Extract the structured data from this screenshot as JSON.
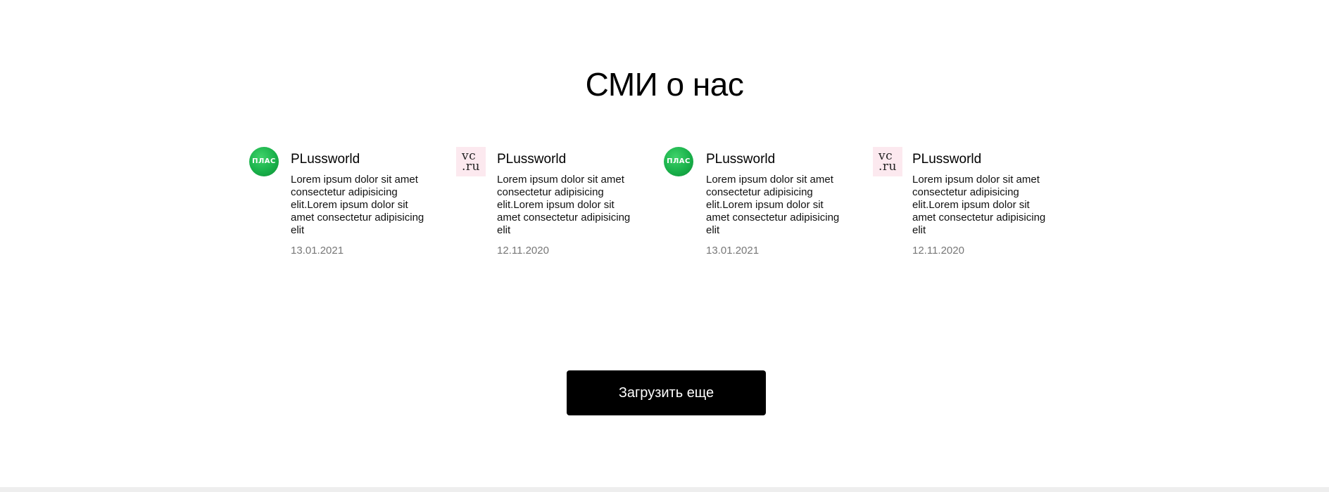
{
  "section": {
    "title": "СМИ о нас"
  },
  "cards": [
    {
      "logo": "plus-logo-icon",
      "logo_text": "ПЛАС",
      "name": "PLussworld",
      "text": "Lorem ipsum dolor sit amet consectetur adipisicing elit.Lorem ipsum dolor sit amet consectetur adipisicing elit",
      "date": "13.01.2021"
    },
    {
      "logo": "vc-ru-logo-icon",
      "logo_text": "vc.ru",
      "name": "PLussworld",
      "text": "Lorem ipsum dolor sit amet consectetur adipisicing elit.Lorem ipsum dolor sit amet consectetur adipisicing elit",
      "date": "12.11.2020"
    },
    {
      "logo": "plus-logo-icon",
      "logo_text": "ПЛАС",
      "name": "PLussworld",
      "text": "Lorem ipsum dolor sit amet consectetur adipisicing elit.Lorem ipsum dolor sit amet consectetur adipisicing elit",
      "date": "13.01.2021"
    },
    {
      "logo": "vc-ru-logo-icon",
      "logo_text": "vc.ru",
      "name": "PLussworld",
      "text": "Lorem ipsum dolor sit amet consectetur adipisicing elit.Lorem ipsum dolor sit amet consectetur adipisicing elit",
      "date": "12.11.2020"
    }
  ],
  "actions": {
    "load_more_label": "Загрузить еще"
  },
  "colors": {
    "button_bg": "#000000",
    "button_text": "#ffffff",
    "date_text": "#777777",
    "plus_green": "#19b14a",
    "vc_bg": "#fce9ef"
  }
}
